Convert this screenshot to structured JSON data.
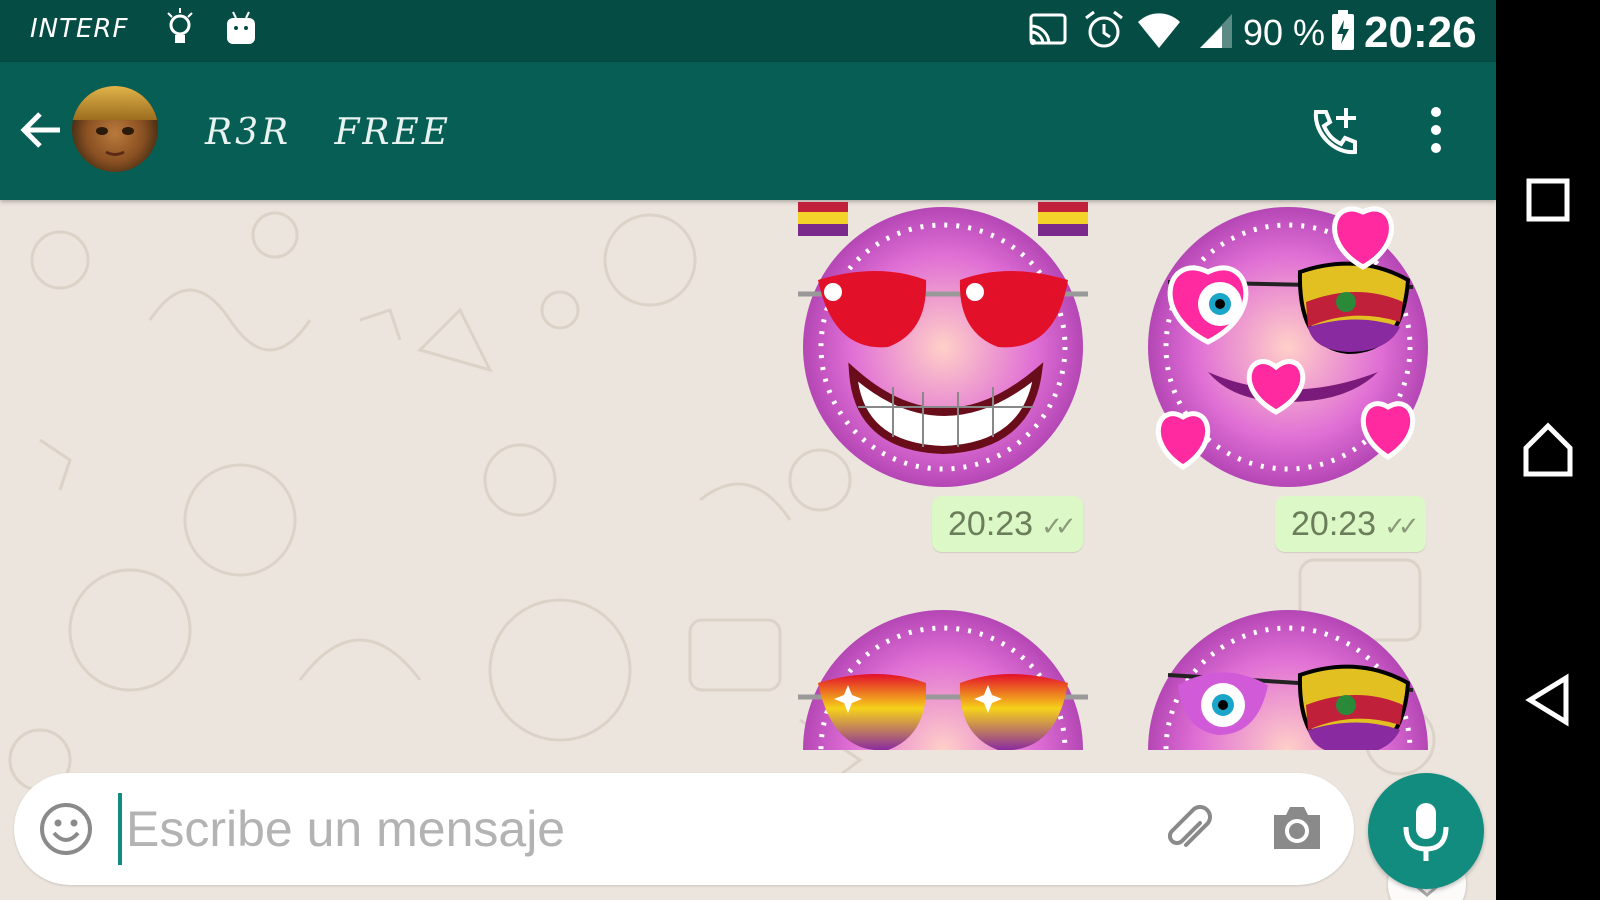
{
  "status_bar": {
    "carrier": "INTERF",
    "battery_percent": "90 %",
    "time": "20:26",
    "icons": [
      "light-bulb-icon",
      "android-icon",
      "cast-icon",
      "alarm-icon",
      "wifi-icon",
      "signal-icon",
      "battery-charging-icon"
    ]
  },
  "header": {
    "title": "R3R   FREE",
    "back_icon": "arrow-left-icon",
    "call_icon": "add-call-icon",
    "menu_icon": "more-vert-icon"
  },
  "messages": [
    {
      "type": "sticker",
      "time": "20:23",
      "status": "read"
    },
    {
      "type": "sticker",
      "time": "20:23",
      "status": "read"
    },
    {
      "type": "sticker",
      "time": "",
      "status": ""
    },
    {
      "type": "sticker",
      "time": "",
      "status": ""
    }
  ],
  "composer": {
    "placeholder": "Escribe un mensaje",
    "value": "",
    "emoji_icon": "emoji-icon",
    "attach_icon": "paperclip-icon",
    "camera_icon": "camera-icon",
    "mic_icon": "microphone-icon"
  },
  "colors": {
    "header": "#075e54",
    "status_bar": "#054d44",
    "accent": "#128c7e",
    "outgoing_bubble": "#dcf8c6",
    "chat_background": "#ece5dd"
  },
  "nav": {
    "icons": [
      "recents-icon",
      "home-icon",
      "back-triangle-icon"
    ]
  }
}
